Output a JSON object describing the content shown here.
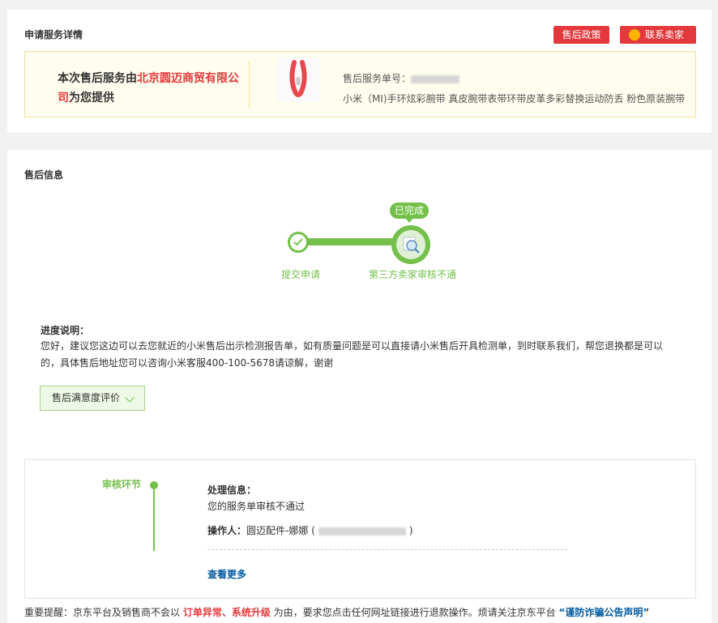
{
  "header": {
    "title": "申请服务详情",
    "policy_button": "售后政策",
    "contact_button": "联系卖家"
  },
  "provider": {
    "prefix": "本次售后服务由",
    "seller": "北京圆迈商贸有限公司",
    "suffix": "为您提供"
  },
  "service": {
    "number_label": "售后服务单号：",
    "product_title": "小米（MI)手环炫彩腕带 真皮腕带表带环带皮革多彩替换运动防丢 粉色原装腕带"
  },
  "aftersale": {
    "title": "售后信息",
    "status_tag": "已完成",
    "steps": [
      "提交申请",
      "第三方卖家审核不通"
    ],
    "desc_title": "进度说明：",
    "desc_text": "您好，建议您这边可以去您就近的小米售后出示检测报告单，如有质量问题是可以直接请小米售后开具检测单，到时联系我们，帮您退换都是可以的，具体售后地址您可以咨询小米客服400-100-5678请谅解，谢谢",
    "rating_button": "售后满意度评价"
  },
  "log": {
    "stage": "审核环节",
    "info_label": "处理信息：",
    "message": "您的服务单审核不通过",
    "operator_label": "操作人：",
    "operator_name": "圆迈配件-娜娜 (",
    "operator_close": ")",
    "more_link": "查看更多"
  },
  "reminder": {
    "p1": "重要提醒：京东平台及销售商不会以 ",
    "h1": "订单异常、系统升级",
    "p2": " 为由，要求您点击任何网址链接进行退款操作。烦请关注京东平台 ",
    "link": "“谨防诈骗公告声明”"
  },
  "colors": {
    "accent_red": "#e4393c",
    "progress_green": "#74c04b",
    "link_blue": "#005aa0"
  }
}
